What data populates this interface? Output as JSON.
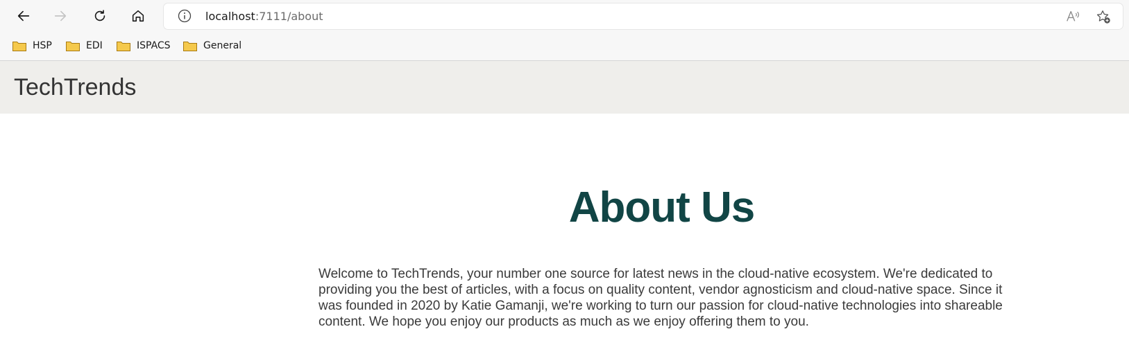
{
  "browser": {
    "url_host": "localhost",
    "url_path": ":7111/about",
    "bookmarks": [
      {
        "label": "HSP"
      },
      {
        "label": "EDI"
      },
      {
        "label": "ISPACS"
      },
      {
        "label": "General"
      }
    ]
  },
  "site": {
    "brand": "TechTrends"
  },
  "main": {
    "heading": "About Us",
    "paragraph": "Welcome to TechTrends, your number one source for latest news in the cloud-native ecosystem. We're dedicated to providing you the best of articles, with a focus on quality content, vendor agnosticism and cloud-native space. Since it was founded in 2020 by Katie Gamanji, we're working to turn our passion for cloud-native technologies into shareable content. We hope you enjoy our products as much as we enjoy offering them to you."
  },
  "colors": {
    "heading": "#114545",
    "header_bg": "#efeeeb",
    "folder": "#f5c94c"
  },
  "icons": [
    "back-arrow-icon",
    "forward-arrow-icon",
    "refresh-icon",
    "home-icon",
    "info-icon",
    "read-aloud-icon",
    "favorite-add-icon",
    "folder-icon"
  ]
}
